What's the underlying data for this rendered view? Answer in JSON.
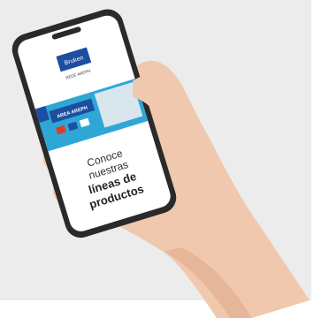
{
  "logo": {
    "brand": "Bruken",
    "tagline": "REDE AREPH"
  },
  "banner": {
    "text": "AREA AREPH"
  },
  "headline": {
    "line1": "Conoce",
    "line2": "nuestras",
    "line3": "líneas de",
    "line4": "productos"
  },
  "colors": {
    "background": "#ececec",
    "phone_frame": "#2a2a2a",
    "screen": "#ffffff",
    "brand_blue": "#1c4fa0",
    "banner_teal": "#2fa7d6",
    "skin": "#f0c8ad"
  }
}
